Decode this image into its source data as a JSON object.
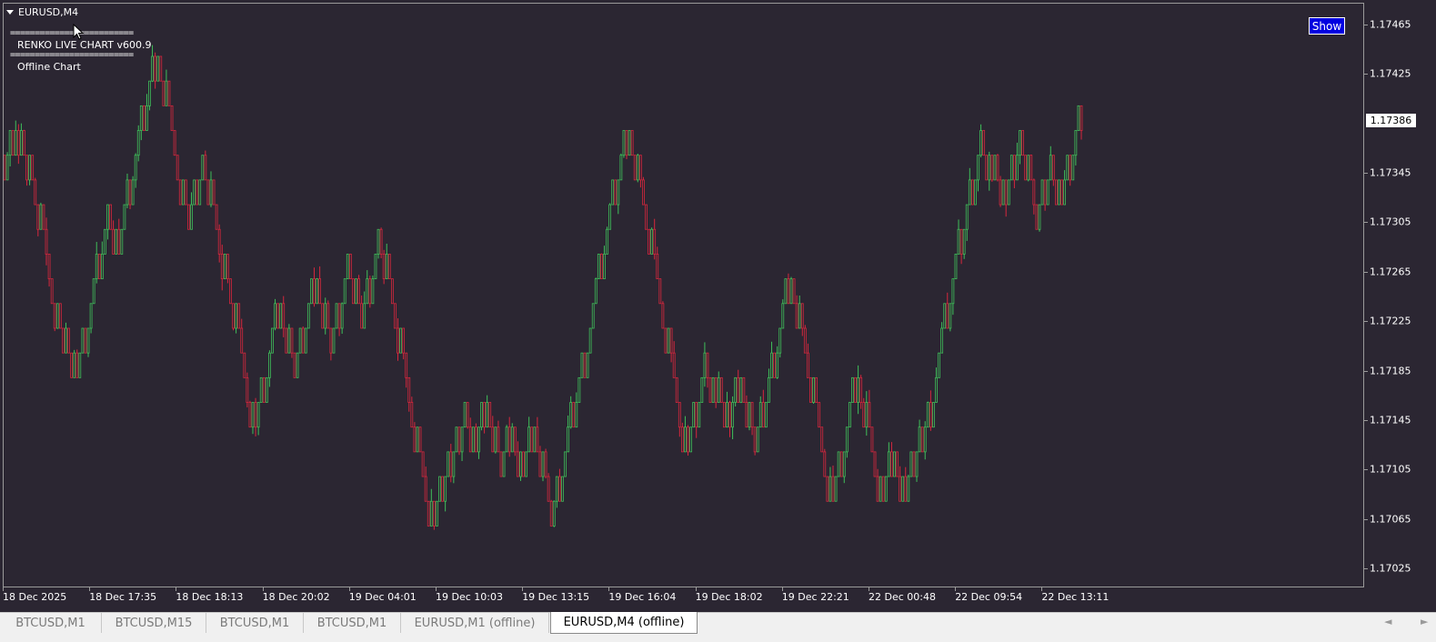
{
  "window": {
    "title": "EURUSD,M4",
    "show_button": "Show",
    "current_price": "1.17386"
  },
  "indicator": {
    "separator": "=========================",
    "name": "RENKO LIVE CHART v600.9",
    "mode": "Offline Chart"
  },
  "colors": {
    "background": "#2b2632",
    "bull": "#3fbf5a",
    "bear": "#d7263d",
    "axis_text": "#ffffff"
  },
  "chart_data": {
    "type": "candlestick",
    "symbol": "EURUSD",
    "timeframe": "M4 (renko offline)",
    "price_axis": {
      "ticks": [
        "1.17465",
        "1.17425",
        "1.17386",
        "1.17345",
        "1.17305",
        "1.17265",
        "1.17225",
        "1.17185",
        "1.17145",
        "1.17105",
        "1.17065",
        "1.17025"
      ],
      "range": [
        1.17004,
        1.1749
      ]
    },
    "time_axis": {
      "ticks": [
        "18 Dec 2025",
        "18 Dec 17:35",
        "18 Dec 18:13",
        "18 Dec 20:02",
        "19 Dec 04:01",
        "19 Dec 10:03",
        "19 Dec 13:15",
        "19 Dec 16:04",
        "19 Dec 18:02",
        "19 Dec 22:21",
        "22 Dec 00:48",
        "22 Dec 09:54",
        "22 Dec 13:11"
      ]
    },
    "brick_size": 0.0002,
    "path": [
      1.1736,
      1.1734,
      1.1738,
      1.1736,
      1.1738,
      1.1734,
      1.1726,
      1.172,
      1.1722,
      1.1718,
      1.1724,
      1.1732,
      1.1728,
      1.173,
      1.174,
      1.1744,
      1.1736,
      1.173,
      1.1736,
      1.1726,
      1.1718,
      1.1714,
      1.1724,
      1.1718,
      1.1722,
      1.1726,
      1.172,
      1.1728,
      1.1722,
      1.173,
      1.1724,
      1.1716,
      1.171,
      1.1706,
      1.1712,
      1.171,
      1.1716,
      1.1712,
      1.1716,
      1.171,
      1.1714,
      1.171,
      1.1714,
      1.1708,
      1.1706,
      1.1716,
      1.1724,
      1.1734,
      1.1738,
      1.1732,
      1.1724,
      1.1716,
      1.1712,
      1.172,
      1.1716,
      1.1718,
      1.1714,
      1.1718,
      1.1712,
      1.1716,
      1.1726,
      1.172,
      1.1712,
      1.1708,
      1.1718,
      1.1712,
      1.1708,
      1.1712,
      1.1708,
      1.1714,
      1.1712,
      1.172,
      1.1726,
      1.173,
      1.1738,
      1.1734,
      1.1736,
      1.1732,
      1.1738,
      1.173,
      1.1736,
      1.1732,
      1.174,
      1.1738
    ]
  },
  "tabs": [
    {
      "label": "BTCUSD,M1"
    },
    {
      "label": "BTCUSD,M15"
    },
    {
      "label": "BTCUSD,M1"
    },
    {
      "label": "BTCUSD,M1"
    },
    {
      "label": "EURUSD,M1 (offline)"
    },
    {
      "label": "EURUSD,M4 (offline)"
    }
  ],
  "scroll": {
    "left": "◄",
    "right": "►"
  }
}
